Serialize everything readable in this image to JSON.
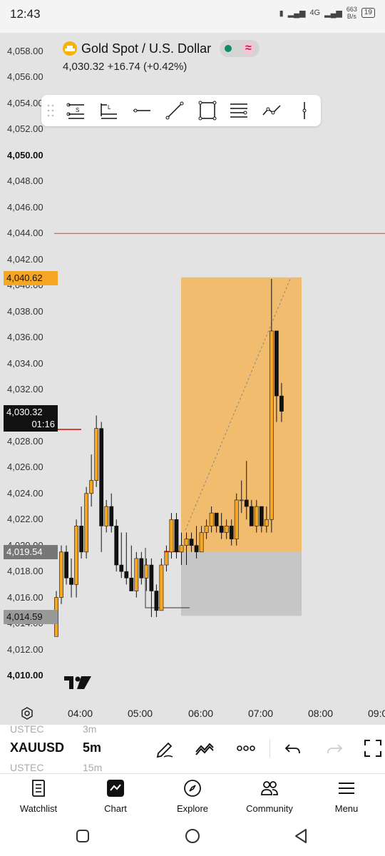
{
  "status": {
    "time": "12:43",
    "net_top": "4G",
    "net_speed": "663",
    "net_unit": "B/s",
    "battery": "19"
  },
  "header": {
    "title": "Gold Spot / U.S. Dollar",
    "quote": "4,030.32  +16.74 (+0.42%)"
  },
  "toolbar": {
    "tools": [
      "info-line-s-icon",
      "info-line-l-icon",
      "horizontal-line-icon",
      "trend-line-icon",
      "rectangle-icon",
      "parallel-lines-icon",
      "path-icon",
      "vertical-line-icon"
    ]
  },
  "yaxis": {
    "labels": [
      "4,058.00",
      "4,056.00",
      "4,054.00",
      "4,052.00",
      "4,050.00",
      "4,048.00",
      "4,046.00",
      "4,044.00",
      "4,042.00",
      "4,040.00",
      "4,038.00",
      "4,036.00",
      "4,034.00",
      "4,032.00",
      "4,030.00",
      "4,028.00",
      "4,026.00",
      "4,024.00",
      "4,022.00",
      "4,020.00",
      "4,018.00",
      "4,016.00",
      "4,014.00",
      "4,012.00",
      "4,010.00"
    ],
    "bold": [
      "4,050.00",
      "4,010.00"
    ]
  },
  "price_tags": {
    "entry": "4,040.62",
    "last": "4,030.32",
    "countdown": "01:16",
    "stop": "4,019.54",
    "target": "4,014.59"
  },
  "xaxis": {
    "labels": [
      "04:00",
      "05:00",
      "06:00",
      "07:00",
      "08:00",
      "09:0"
    ]
  },
  "bottom": {
    "symbol": "XAUUSD",
    "interval": "5m",
    "ghost_top_symbol": "USTEC",
    "ghost_top_interval": "3m",
    "ghost_bottom_symbol": "USTEC",
    "ghost_bottom_interval": "15m"
  },
  "nav": {
    "items": [
      "Watchlist",
      "Chart",
      "Explore",
      "Community",
      "Menu"
    ]
  },
  "colors": {
    "up": "#f5a623",
    "down": "#111111",
    "alert_line": "#e53935",
    "profit_zone": "#f2bc6e",
    "loss_zone": "#c6c6c6"
  },
  "chart_data": {
    "type": "candlestick",
    "title": "Gold Spot / U.S. Dollar",
    "ylim": [
      4009,
      4059
    ],
    "candles": [
      {
        "t": "03:40",
        "o": 4013.0,
        "h": 4016.5,
        "l": 4013.0,
        "c": 4016.0
      },
      {
        "t": "03:45",
        "o": 4016.0,
        "h": 4020.0,
        "l": 4015.5,
        "c": 4019.5
      },
      {
        "t": "03:50",
        "o": 4019.5,
        "h": 4020.0,
        "l": 4017.0,
        "c": 4017.5
      },
      {
        "t": "03:55",
        "o": 4017.5,
        "h": 4019.0,
        "l": 4016.0,
        "c": 4017.0
      },
      {
        "t": "04:00",
        "o": 4017.0,
        "h": 4022.0,
        "l": 4016.0,
        "c": 4021.5
      },
      {
        "t": "04:05",
        "o": 4021.5,
        "h": 4023.0,
        "l": 4019.0,
        "c": 4019.5
      },
      {
        "t": "04:10",
        "o": 4019.5,
        "h": 4024.5,
        "l": 4019.0,
        "c": 4024.0
      },
      {
        "t": "04:15",
        "o": 4024.0,
        "h": 4027.0,
        "l": 4023.0,
        "c": 4025.0
      },
      {
        "t": "04:20",
        "o": 4025.0,
        "h": 4030.0,
        "l": 4024.5,
        "c": 4029.0
      },
      {
        "t": "04:25",
        "o": 4029.0,
        "h": 4029.5,
        "l": 4019.5,
        "c": 4021.5
      },
      {
        "t": "04:30",
        "o": 4021.5,
        "h": 4023.5,
        "l": 4021.0,
        "c": 4023.0
      },
      {
        "t": "04:35",
        "o": 4023.0,
        "h": 4024.0,
        "l": 4021.0,
        "c": 4021.5
      },
      {
        "t": "04:40",
        "o": 4021.5,
        "h": 4022.0,
        "l": 4018.0,
        "c": 4018.5
      },
      {
        "t": "04:45",
        "o": 4018.5,
        "h": 4021.0,
        "l": 4017.5,
        "c": 4018.0
      },
      {
        "t": "04:50",
        "o": 4018.0,
        "h": 4021.0,
        "l": 4017.0,
        "c": 4017.5
      },
      {
        "t": "04:55",
        "o": 4017.5,
        "h": 4020.0,
        "l": 4016.5,
        "c": 4016.5
      },
      {
        "t": "05:00",
        "o": 4016.5,
        "h": 4019.5,
        "l": 4016.0,
        "c": 4019.0
      },
      {
        "t": "05:05",
        "o": 4019.0,
        "h": 4019.5,
        "l": 4017.0,
        "c": 4017.5
      },
      {
        "t": "05:10",
        "o": 4017.5,
        "h": 4019.0,
        "l": 4016.5,
        "c": 4018.5
      },
      {
        "t": "05:15",
        "o": 4018.5,
        "h": 4019.0,
        "l": 4014.5,
        "c": 4016.5
      },
      {
        "t": "05:20",
        "o": 4016.5,
        "h": 4017.0,
        "l": 4014.5,
        "c": 4015.0
      },
      {
        "t": "05:25",
        "o": 4015.0,
        "h": 4019.0,
        "l": 4015.0,
        "c": 4018.5
      },
      {
        "t": "05:30",
        "o": 4018.5,
        "h": 4020.0,
        "l": 4018.0,
        "c": 4019.5
      },
      {
        "t": "05:35",
        "o": 4019.5,
        "h": 4022.5,
        "l": 4019.0,
        "c": 4022.0
      },
      {
        "t": "05:40",
        "o": 4022.0,
        "h": 4022.5,
        "l": 4019.0,
        "c": 4019.5
      },
      {
        "t": "05:45",
        "o": 4019.5,
        "h": 4021.0,
        "l": 4018.5,
        "c": 4020.0
      },
      {
        "t": "05:50",
        "o": 4020.0,
        "h": 4021.0,
        "l": 4018.5,
        "c": 4020.5
      },
      {
        "t": "05:55",
        "o": 4020.5,
        "h": 4021.0,
        "l": 4019.5,
        "c": 4020.0
      },
      {
        "t": "06:00",
        "o": 4020.0,
        "h": 4021.5,
        "l": 4019.0,
        "c": 4019.5
      },
      {
        "t": "06:05",
        "o": 4019.5,
        "h": 4021.5,
        "l": 4019.5,
        "c": 4021.0
      },
      {
        "t": "06:10",
        "o": 4021.0,
        "h": 4022.0,
        "l": 4020.5,
        "c": 4021.5
      },
      {
        "t": "06:15",
        "o": 4021.5,
        "h": 4023.0,
        "l": 4021.0,
        "c": 4022.5
      },
      {
        "t": "06:20",
        "o": 4022.5,
        "h": 4022.5,
        "l": 4021.0,
        "c": 4021.5
      },
      {
        "t": "06:25",
        "o": 4021.5,
        "h": 4022.5,
        "l": 4020.5,
        "c": 4021.0
      },
      {
        "t": "06:30",
        "o": 4021.0,
        "h": 4022.0,
        "l": 4020.5,
        "c": 4021.5
      },
      {
        "t": "06:35",
        "o": 4021.5,
        "h": 4022.0,
        "l": 4020.0,
        "c": 4020.5
      },
      {
        "t": "06:40",
        "o": 4020.5,
        "h": 4024.0,
        "l": 4020.0,
        "c": 4023.5
      },
      {
        "t": "06:45",
        "o": 4023.5,
        "h": 4025.0,
        "l": 4022.5,
        "c": 4023.5
      },
      {
        "t": "06:50",
        "o": 4023.5,
        "h": 4026.5,
        "l": 4022.0,
        "c": 4023.0
      },
      {
        "t": "06:55",
        "o": 4023.0,
        "h": 4023.5,
        "l": 4021.5,
        "c": 4021.5
      },
      {
        "t": "07:00",
        "o": 4021.5,
        "h": 4023.5,
        "l": 4021.0,
        "c": 4023.0
      },
      {
        "t": "07:05",
        "o": 4023.0,
        "h": 4023.0,
        "l": 4021.0,
        "c": 4021.5
      },
      {
        "t": "07:10",
        "o": 4021.5,
        "h": 4023.0,
        "l": 4021.0,
        "c": 4022.0
      },
      {
        "t": "07:15",
        "o": 4022.0,
        "h": 4040.5,
        "l": 4021.0,
        "c": 4036.5
      },
      {
        "t": "07:20",
        "o": 4036.5,
        "h": 4036.5,
        "l": 4029.5,
        "c": 4031.5
      },
      {
        "t": "07:25",
        "o": 4031.5,
        "h": 4032.5,
        "l": 4029.5,
        "c": 4030.32
      }
    ],
    "position": {
      "type": "long",
      "entry": 4019.54,
      "target": 4040.62,
      "stop": 4014.59
    },
    "horizontal_line": 4044.0
  }
}
